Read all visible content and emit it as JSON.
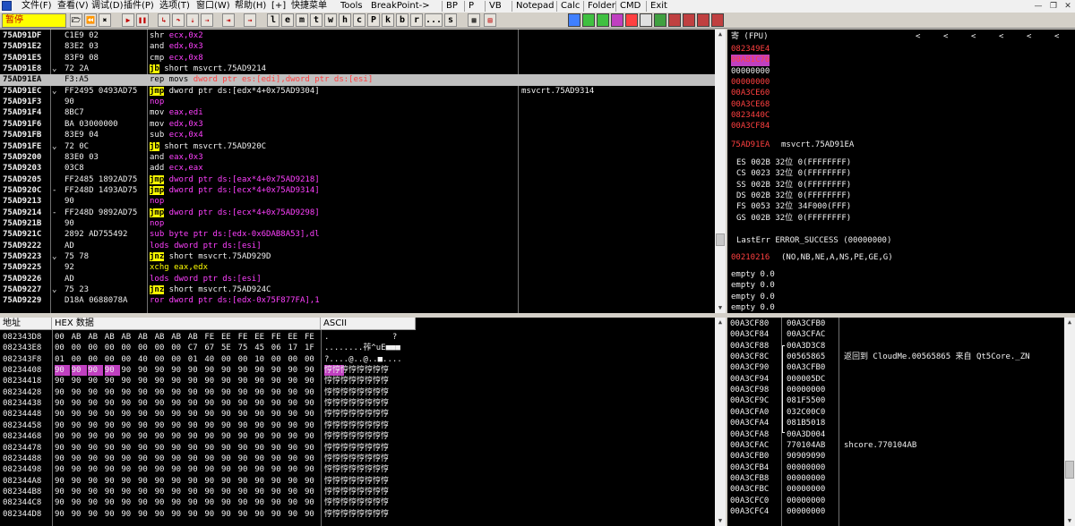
{
  "menu": {
    "items": [
      "文件(F)",
      "查看(V)",
      "调试(D)",
      "插件(P)",
      "选项(T)",
      "窗口(W)",
      "帮助(H)",
      "[+]",
      "快捷菜单",
      "Tools",
      "BreakPoint->"
    ],
    "tabs": [
      "BP",
      "P",
      "VB",
      "Notepad",
      "Calc",
      "Folder",
      "CMD",
      "Exit"
    ]
  },
  "toolbar": {
    "status": "暂停",
    "letters": [
      "l",
      "e",
      "m",
      "t",
      "w",
      "h",
      "c",
      "P",
      "k",
      "b",
      "r",
      "...",
      "s"
    ]
  },
  "disasm": [
    {
      "addr": "75AD91DF",
      "mark": "",
      "hex": "C1E9 02",
      "asm": [
        [
          "w",
          "shr "
        ],
        [
          "m",
          "ecx,0x2"
        ]
      ],
      "cmt": ""
    },
    {
      "addr": "75AD91E2",
      "mark": "",
      "hex": "83E2 03",
      "asm": [
        [
          "w",
          "and "
        ],
        [
          "m",
          "edx,0x3"
        ]
      ],
      "cmt": ""
    },
    {
      "addr": "75AD91E5",
      "mark": "",
      "hex": "83F9 08",
      "asm": [
        [
          "w",
          "cmp "
        ],
        [
          "m",
          "ecx,0x8"
        ]
      ],
      "cmt": ""
    },
    {
      "addr": "75AD91E8",
      "mark": "⌄",
      "hex": "72 2A",
      "asm": [
        [
          "jb",
          "jb"
        ],
        [
          "w",
          " short msvcrt.75AD9214"
        ]
      ],
      "cmt": ""
    },
    {
      "addr": "75AD91EA",
      "mark": "",
      "hex": "F3:A5",
      "asm": [
        [
          "m",
          "rep movs "
        ],
        [
          "r",
          "dword ptr es:[edi],dword ptr ds:[esi]"
        ]
      ],
      "cmt": "",
      "sel": true
    },
    {
      "addr": "75AD91EC",
      "mark": "⌄",
      "hex": "FF2495 0493AD75",
      "asm": [
        [
          "jb",
          "jmp"
        ],
        [
          "w",
          " dword ptr ds:[edx*4+0x75AD9304]"
        ]
      ],
      "cmt": "msvcrt.75AD9314"
    },
    {
      "addr": "75AD91F3",
      "mark": "",
      "hex": "90",
      "asm": [
        [
          "m",
          "nop"
        ]
      ],
      "cmt": ""
    },
    {
      "addr": "75AD91F4",
      "mark": "",
      "hex": "8BC7",
      "asm": [
        [
          "w",
          "mov "
        ],
        [
          "m",
          "eax,edi"
        ]
      ],
      "cmt": ""
    },
    {
      "addr": "75AD91F6",
      "mark": "",
      "hex": "BA 03000000",
      "asm": [
        [
          "w",
          "mov "
        ],
        [
          "m",
          "edx,0x3"
        ]
      ],
      "cmt": ""
    },
    {
      "addr": "75AD91FB",
      "mark": "",
      "hex": "83E9 04",
      "asm": [
        [
          "w",
          "sub "
        ],
        [
          "m",
          "ecx,0x4"
        ]
      ],
      "cmt": ""
    },
    {
      "addr": "75AD91FE",
      "mark": "⌄",
      "hex": "72 0C",
      "asm": [
        [
          "jb",
          "jb"
        ],
        [
          "w",
          " short msvcrt.75AD920C"
        ]
      ],
      "cmt": ""
    },
    {
      "addr": "75AD9200",
      "mark": "",
      "hex": "83E0 03",
      "asm": [
        [
          "w",
          "and "
        ],
        [
          "m",
          "eax,0x3"
        ]
      ],
      "cmt": ""
    },
    {
      "addr": "75AD9203",
      "mark": "",
      "hex": "03C8",
      "asm": [
        [
          "w",
          "add "
        ],
        [
          "m",
          "ecx,eax"
        ]
      ],
      "cmt": ""
    },
    {
      "addr": "75AD9205",
      "mark": "",
      "hex": "FF2485 1892AD75",
      "asm": [
        [
          "jb",
          "jmp"
        ],
        [
          "m",
          " dword ptr ds:[eax*4+0x75AD9218]"
        ]
      ],
      "cmt": ""
    },
    {
      "addr": "75AD920C",
      "mark": "-",
      "hex": "FF248D 1493AD75",
      "asm": [
        [
          "jb",
          "jmp"
        ],
        [
          "m",
          " dword ptr ds:[ecx*4+0x75AD9314]"
        ]
      ],
      "cmt": ""
    },
    {
      "addr": "75AD9213",
      "mark": "",
      "hex": "90",
      "asm": [
        [
          "m",
          "nop"
        ]
      ],
      "cmt": ""
    },
    {
      "addr": "75AD9214",
      "mark": "-",
      "hex": "FF248D 9892AD75",
      "asm": [
        [
          "jb",
          "jmp"
        ],
        [
          "m",
          " dword ptr ds:[ecx*4+0x75AD9298]"
        ]
      ],
      "cmt": ""
    },
    {
      "addr": "75AD921B",
      "mark": "",
      "hex": "90",
      "asm": [
        [
          "m",
          "nop"
        ]
      ],
      "cmt": ""
    },
    {
      "addr": "75AD921C",
      "mark": "",
      "hex": "2892 AD755492",
      "asm": [
        [
          "m",
          "sub byte ptr ds:[edx-0x6DAB8A53],dl"
        ]
      ],
      "cmt": ""
    },
    {
      "addr": "75AD9222",
      "mark": "",
      "hex": "AD",
      "asm": [
        [
          "m",
          "lods dword ptr ds:[esi]"
        ]
      ],
      "cmt": ""
    },
    {
      "addr": "75AD9223",
      "mark": "⌄",
      "hex": "75 78",
      "asm": [
        [
          "jb",
          "jnz"
        ],
        [
          "w",
          " short msvcrt.75AD929D"
        ]
      ],
      "cmt": ""
    },
    {
      "addr": "75AD9225",
      "mark": "",
      "hex": "92",
      "asm": [
        [
          "y",
          "xchg eax,edx"
        ]
      ],
      "cmt": ""
    },
    {
      "addr": "75AD9226",
      "mark": "",
      "hex": "AD",
      "asm": [
        [
          "m",
          "lods dword ptr ds:[esi]"
        ]
      ],
      "cmt": ""
    },
    {
      "addr": "75AD9227",
      "mark": "⌄",
      "hex": "75 23",
      "asm": [
        [
          "jb",
          "jnz"
        ],
        [
          "w",
          " short msvcrt.75AD924C"
        ]
      ],
      "cmt": ""
    },
    {
      "addr": "75AD9229",
      "mark": "",
      "hex": "D18A 0688078A",
      "asm": [
        [
          "m",
          "ror dword ptr ds:[edx-0x75F877FA],1"
        ]
      ],
      "cmt": ""
    }
  ],
  "registers": {
    "title": "寄 (FPU)",
    "arrows": [
      "<",
      "<",
      "<",
      "<",
      "<",
      "<"
    ],
    "regs": [
      {
        "v": "082349E4",
        "c": "r"
      },
      {
        "v": "00A81C76",
        "c": "sel"
      },
      {
        "v": "00000000",
        "c": "w"
      },
      {
        "v": "00000000",
        "c": "r"
      },
      {
        "v": "00A3CE60",
        "c": "r"
      },
      {
        "v": "00A3CE68",
        "c": "r"
      },
      {
        "v": "0823440C",
        "c": "r"
      },
      {
        "v": "00A3CF84",
        "c": "r"
      }
    ],
    "eip": {
      "v": "75AD91EA",
      "c": "msvcrt.75AD91EA"
    },
    "segs": [
      "ES 002B 32位 0(FFFFFFFF)",
      "CS 0023 32位 0(FFFFFFFF)",
      "SS 002B 32位 0(FFFFFFFF)",
      "DS 002B 32位 0(FFFFFFFF)",
      "FS 0053 32位 34F000(FFF)",
      "GS 002B 32位 0(FFFFFFFF)"
    ],
    "lasterr": "LastErr ERROR_SUCCESS (00000000)",
    "efl_v": "00210216",
    "efl_t": "(NO,NB,NE,A,NS,PE,GE,G)",
    "fpu": [
      "empty 0.0",
      "empty 0.0",
      "empty 0.0",
      "empty 0.0"
    ]
  },
  "dump": {
    "headers": {
      "addr": "地址",
      "hex": "HEX 数据",
      "ascii": "ASCII"
    },
    "rows": [
      {
        "a": "082343D8",
        "h": [
          "00",
          "AB",
          "AB",
          "AB",
          "AB",
          "AB",
          "AB",
          "AB",
          "AB",
          "FE",
          "EE",
          "FE",
          "EE",
          "FE",
          "EE",
          "FE"
        ],
        "t": ".             ?"
      },
      {
        "a": "082343E8",
        "h": [
          "00",
          "00",
          "00",
          "00",
          "00",
          "00",
          "00",
          "00",
          "C7",
          "67",
          "5E",
          "75",
          "45",
          "06",
          "17",
          "1F"
        ],
        "t": "........莋^uE■■■"
      },
      {
        "a": "082343F8",
        "h": [
          "01",
          "00",
          "00",
          "00",
          "00",
          "40",
          "00",
          "00",
          "01",
          "40",
          "00",
          "00",
          "10",
          "00",
          "00",
          "00"
        ],
        "t": "?....@..@..■...."
      },
      {
        "a": "08234408",
        "h": [
          "90",
          "90",
          "90",
          "90",
          "90",
          "90",
          "90",
          "90",
          "90",
          "90",
          "90",
          "90",
          "90",
          "90",
          "90",
          "90"
        ],
        "t": "悙悙悙悙悙悙悙悙",
        "sel": 4
      },
      {
        "a": "08234418",
        "h": [
          "90",
          "90",
          "90",
          "90",
          "90",
          "90",
          "90",
          "90",
          "90",
          "90",
          "90",
          "90",
          "90",
          "90",
          "90",
          "90"
        ],
        "t": "悙悙悙悙悙悙悙悙"
      },
      {
        "a": "08234428",
        "h": [
          "90",
          "90",
          "90",
          "90",
          "90",
          "90",
          "90",
          "90",
          "90",
          "90",
          "90",
          "90",
          "90",
          "90",
          "90",
          "90"
        ],
        "t": "悙悙悙悙悙悙悙悙"
      },
      {
        "a": "08234438",
        "h": [
          "90",
          "90",
          "90",
          "90",
          "90",
          "90",
          "90",
          "90",
          "90",
          "90",
          "90",
          "90",
          "90",
          "90",
          "90",
          "90"
        ],
        "t": "悙悙悙悙悙悙悙悙"
      },
      {
        "a": "08234448",
        "h": [
          "90",
          "90",
          "90",
          "90",
          "90",
          "90",
          "90",
          "90",
          "90",
          "90",
          "90",
          "90",
          "90",
          "90",
          "90",
          "90"
        ],
        "t": "悙悙悙悙悙悙悙悙"
      },
      {
        "a": "08234458",
        "h": [
          "90",
          "90",
          "90",
          "90",
          "90",
          "90",
          "90",
          "90",
          "90",
          "90",
          "90",
          "90",
          "90",
          "90",
          "90",
          "90"
        ],
        "t": "悙悙悙悙悙悙悙悙"
      },
      {
        "a": "08234468",
        "h": [
          "90",
          "90",
          "90",
          "90",
          "90",
          "90",
          "90",
          "90",
          "90",
          "90",
          "90",
          "90",
          "90",
          "90",
          "90",
          "90"
        ],
        "t": "悙悙悙悙悙悙悙悙"
      },
      {
        "a": "08234478",
        "h": [
          "90",
          "90",
          "90",
          "90",
          "90",
          "90",
          "90",
          "90",
          "90",
          "90",
          "90",
          "90",
          "90",
          "90",
          "90",
          "90"
        ],
        "t": "悙悙悙悙悙悙悙悙"
      },
      {
        "a": "08234488",
        "h": [
          "90",
          "90",
          "90",
          "90",
          "90",
          "90",
          "90",
          "90",
          "90",
          "90",
          "90",
          "90",
          "90",
          "90",
          "90",
          "90"
        ],
        "t": "悙悙悙悙悙悙悙悙"
      },
      {
        "a": "08234498",
        "h": [
          "90",
          "90",
          "90",
          "90",
          "90",
          "90",
          "90",
          "90",
          "90",
          "90",
          "90",
          "90",
          "90",
          "90",
          "90",
          "90"
        ],
        "t": "悙悙悙悙悙悙悙悙"
      },
      {
        "a": "082344A8",
        "h": [
          "90",
          "90",
          "90",
          "90",
          "90",
          "90",
          "90",
          "90",
          "90",
          "90",
          "90",
          "90",
          "90",
          "90",
          "90",
          "90"
        ],
        "t": "悙悙悙悙悙悙悙悙"
      },
      {
        "a": "082344B8",
        "h": [
          "90",
          "90",
          "90",
          "90",
          "90",
          "90",
          "90",
          "90",
          "90",
          "90",
          "90",
          "90",
          "90",
          "90",
          "90",
          "90"
        ],
        "t": "悙悙悙悙悙悙悙悙"
      },
      {
        "a": "082344C8",
        "h": [
          "90",
          "90",
          "90",
          "90",
          "90",
          "90",
          "90",
          "90",
          "90",
          "90",
          "90",
          "90",
          "90",
          "90",
          "90",
          "90"
        ],
        "t": "悙悙悙悙悙悙悙悙"
      },
      {
        "a": "082344D8",
        "h": [
          "90",
          "90",
          "90",
          "90",
          "90",
          "90",
          "90",
          "90",
          "90",
          "90",
          "90",
          "90",
          "90",
          "90",
          "90",
          "90"
        ],
        "t": "悙悙悙悙悙悙悙悙"
      }
    ]
  },
  "stack": [
    {
      "a": "00A3CF80",
      "v": "00A3CFB0",
      "c": ""
    },
    {
      "a": "00A3CF84",
      "v": "00A3CFAC",
      "c": ""
    },
    {
      "a": "00A3CF88",
      "v": "00A3D3C8",
      "c": "",
      "br": "top"
    },
    {
      "a": "00A3CF8C",
      "v": "00565865",
      "c": "返回到 CloudMe.00565865 来自 Qt5Core._ZN"
    },
    {
      "a": "00A3CF90",
      "v": "00A3CFB0",
      "c": ""
    },
    {
      "a": "00A3CF94",
      "v": "000005DC",
      "c": ""
    },
    {
      "a": "00A3CF98",
      "v": "00000000",
      "c": ""
    },
    {
      "a": "00A3CF9C",
      "v": "081F5500",
      "c": ""
    },
    {
      "a": "00A3CFA0",
      "v": "032C00C0",
      "c": ""
    },
    {
      "a": "00A3CFA4",
      "v": "081B5018",
      "c": ""
    },
    {
      "a": "00A3CFA8",
      "v": "00A3D004",
      "c": ""
    },
    {
      "a": "00A3CFAC",
      "v": "770104AB",
      "c": "shcore.770104AB"
    },
    {
      "a": "00A3CFB0",
      "v": "90909090",
      "c": ""
    },
    {
      "a": "00A3CFB4",
      "v": "00000000",
      "c": ""
    },
    {
      "a": "00A3CFB8",
      "v": "00000000",
      "c": ""
    },
    {
      "a": "00A3CFBC",
      "v": "00000000",
      "c": ""
    },
    {
      "a": "00A3CFC0",
      "v": "00000000",
      "c": ""
    },
    {
      "a": "00A3CFC4",
      "v": "00000000",
      "c": ""
    }
  ],
  "colors": {
    "accent": "#ffff00",
    "address": "#f0f0f0",
    "instruction": "#ff40ff",
    "register_changed": "#ff4040"
  },
  "icons": {
    "close": "close-icon",
    "minimize": "minimize-icon",
    "restore": "restore-icon"
  }
}
